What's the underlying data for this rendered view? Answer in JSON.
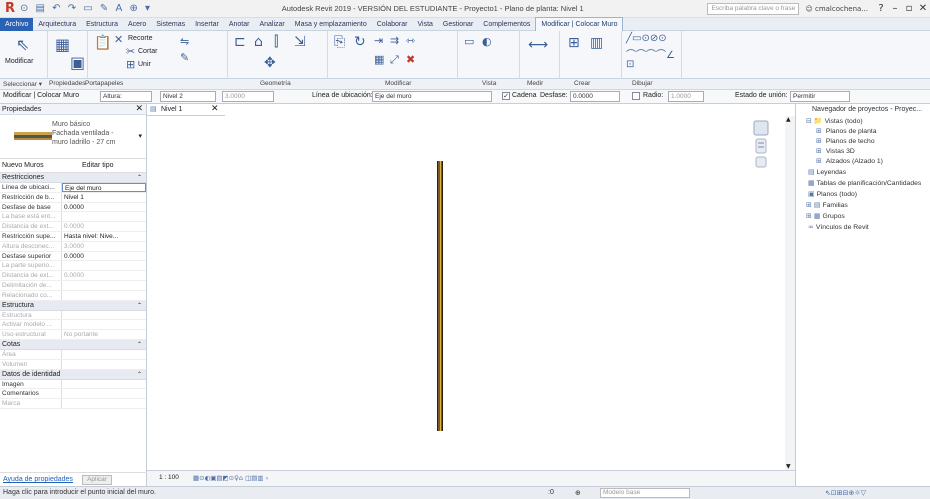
{
  "titlebar": {
    "app_title": "Autodesk Revit 2019 - VERSIÓN DEL ESTUDIANTE - Proyecto1 - Plano de planta: Nivel 1",
    "search_placeholder": "Escriba palabra clave o frase",
    "user": "cmalcochena...",
    "help": "?"
  },
  "tabs": [
    "Archivo",
    "Arquitectura",
    "Estructura",
    "Acero",
    "Sistemas",
    "Insertar",
    "Anotar",
    "Analizar",
    "Masa y emplazamiento",
    "Colaborar",
    "Vista",
    "Gestionar",
    "Complementos",
    "Modificar | Colocar Muro"
  ],
  "ribbon": {
    "modify_label": "Modificar",
    "clipboard": {
      "recortar": "Recorte",
      "cortar": "Cortar",
      "unir": "Unir"
    }
  },
  "panels": [
    "Seleccionar ▾",
    "Propiedades",
    "Portapapeles",
    "Geometría",
    "Modificar",
    "Vista",
    "Medir",
    "Crear",
    "Dibujar"
  ],
  "options_bar": {
    "context": "Modificar | Colocar Muro",
    "height_mode": "Altura:",
    "level": "Nivel 2",
    "height_value": "3.0000",
    "location_line_label": "Línea de ubicación:",
    "location_line_value": "Eje del muro",
    "chain_label": "Cadena",
    "chain_checked": true,
    "offset_label": "Desfase:",
    "offset_value": "0.0000",
    "radius_label": "Radio:",
    "radius_value": "1.0000",
    "radius_checked": false,
    "join_label": "Estado de unión:",
    "join_value": "Permitir"
  },
  "properties": {
    "header": "Propiedades",
    "type_family": "Muro básico",
    "type_name_1": "Fachada ventilada -",
    "type_name_2": "muro ladrillo - 27 cm",
    "instance_selector": "Nuevo Muros",
    "edit_type": "Editar tipo",
    "categories": [
      {
        "name": "Restricciones",
        "rows": [
          {
            "k": "Línea de ubicaci...",
            "v": "Eje del muro",
            "disabled": false,
            "edit": true
          },
          {
            "k": "Restricción de b...",
            "v": "Nivel 1",
            "disabled": false
          },
          {
            "k": "Desfase de base",
            "v": "0.0000",
            "disabled": false
          },
          {
            "k": "La base está ent...",
            "v": "",
            "disabled": true
          },
          {
            "k": "Distancia de ext...",
            "v": "0.0000",
            "disabled": true
          },
          {
            "k": "Restricción supe...",
            "v": "Hasta nivel: Nive...",
            "disabled": false
          },
          {
            "k": "Altura desconec...",
            "v": "3.0000",
            "disabled": true
          },
          {
            "k": "Desfase superior",
            "v": "0.0000",
            "disabled": false
          },
          {
            "k": "La parte superio...",
            "v": "",
            "disabled": true
          },
          {
            "k": "Distancia de ext...",
            "v": "0.0000",
            "disabled": true
          },
          {
            "k": "Delimitación de...",
            "v": "",
            "disabled": true
          },
          {
            "k": "Relacionado co...",
            "v": "",
            "disabled": true
          }
        ]
      },
      {
        "name": "Estructura",
        "rows": [
          {
            "k": "Estructura",
            "v": "",
            "disabled": true
          },
          {
            "k": "Activar modelo ...",
            "v": "",
            "disabled": true
          },
          {
            "k": "Uso estructural",
            "v": "No portante",
            "disabled": true
          }
        ]
      },
      {
        "name": "Cotas",
        "rows": [
          {
            "k": "Área",
            "v": "",
            "disabled": true
          },
          {
            "k": "Volumen",
            "v": "",
            "disabled": true
          }
        ]
      },
      {
        "name": "Datos de identidad",
        "rows": [
          {
            "k": "Imagen",
            "v": "",
            "disabled": false
          },
          {
            "k": "Comentarios",
            "v": "",
            "disabled": false
          },
          {
            "k": "Marca",
            "v": "",
            "disabled": true
          }
        ]
      }
    ],
    "help_link": "Ayuda de propiedades",
    "apply": "Aplicar"
  },
  "view_tab": {
    "label": "Nivel 1"
  },
  "view_control": {
    "scale": "1 : 100"
  },
  "browser": {
    "title": "Navegador de proyectos - Proyec...",
    "nodes": [
      {
        "label": "Vistas (todo)",
        "indent": 0,
        "toggle": "⊟",
        "icon": "📁"
      },
      {
        "label": "Planos de planta",
        "indent": 1,
        "toggle": "⊞",
        "icon": ""
      },
      {
        "label": "Planos de techo",
        "indent": 1,
        "toggle": "⊞",
        "icon": ""
      },
      {
        "label": "Vistas 3D",
        "indent": 1,
        "toggle": "⊞",
        "icon": ""
      },
      {
        "label": "Alzados (Alzado 1)",
        "indent": 1,
        "toggle": "⊞",
        "icon": ""
      },
      {
        "label": "Leyendas",
        "indent": 0,
        "toggle": "",
        "icon": "▤"
      },
      {
        "label": "Tablas de planificación/Cantidades",
        "indent": 0,
        "toggle": "",
        "icon": "▦"
      },
      {
        "label": "Planos (todo)",
        "indent": 0,
        "toggle": "",
        "icon": "▣"
      },
      {
        "label": "Familias",
        "indent": 0,
        "toggle": "⊞",
        "icon": "▤"
      },
      {
        "label": "Grupos",
        "indent": 0,
        "toggle": "⊞",
        "icon": "▦"
      },
      {
        "label": "Vínculos de Revit",
        "indent": 0,
        "toggle": "",
        "icon": "∞"
      }
    ]
  },
  "status": {
    "message": "Haga clic para introducir el punto inicial del muro.",
    "model": "Modelo base",
    "zero": ":0"
  },
  "colors": {
    "accent": "#2a62b4",
    "wall": "#7b5a2a"
  }
}
